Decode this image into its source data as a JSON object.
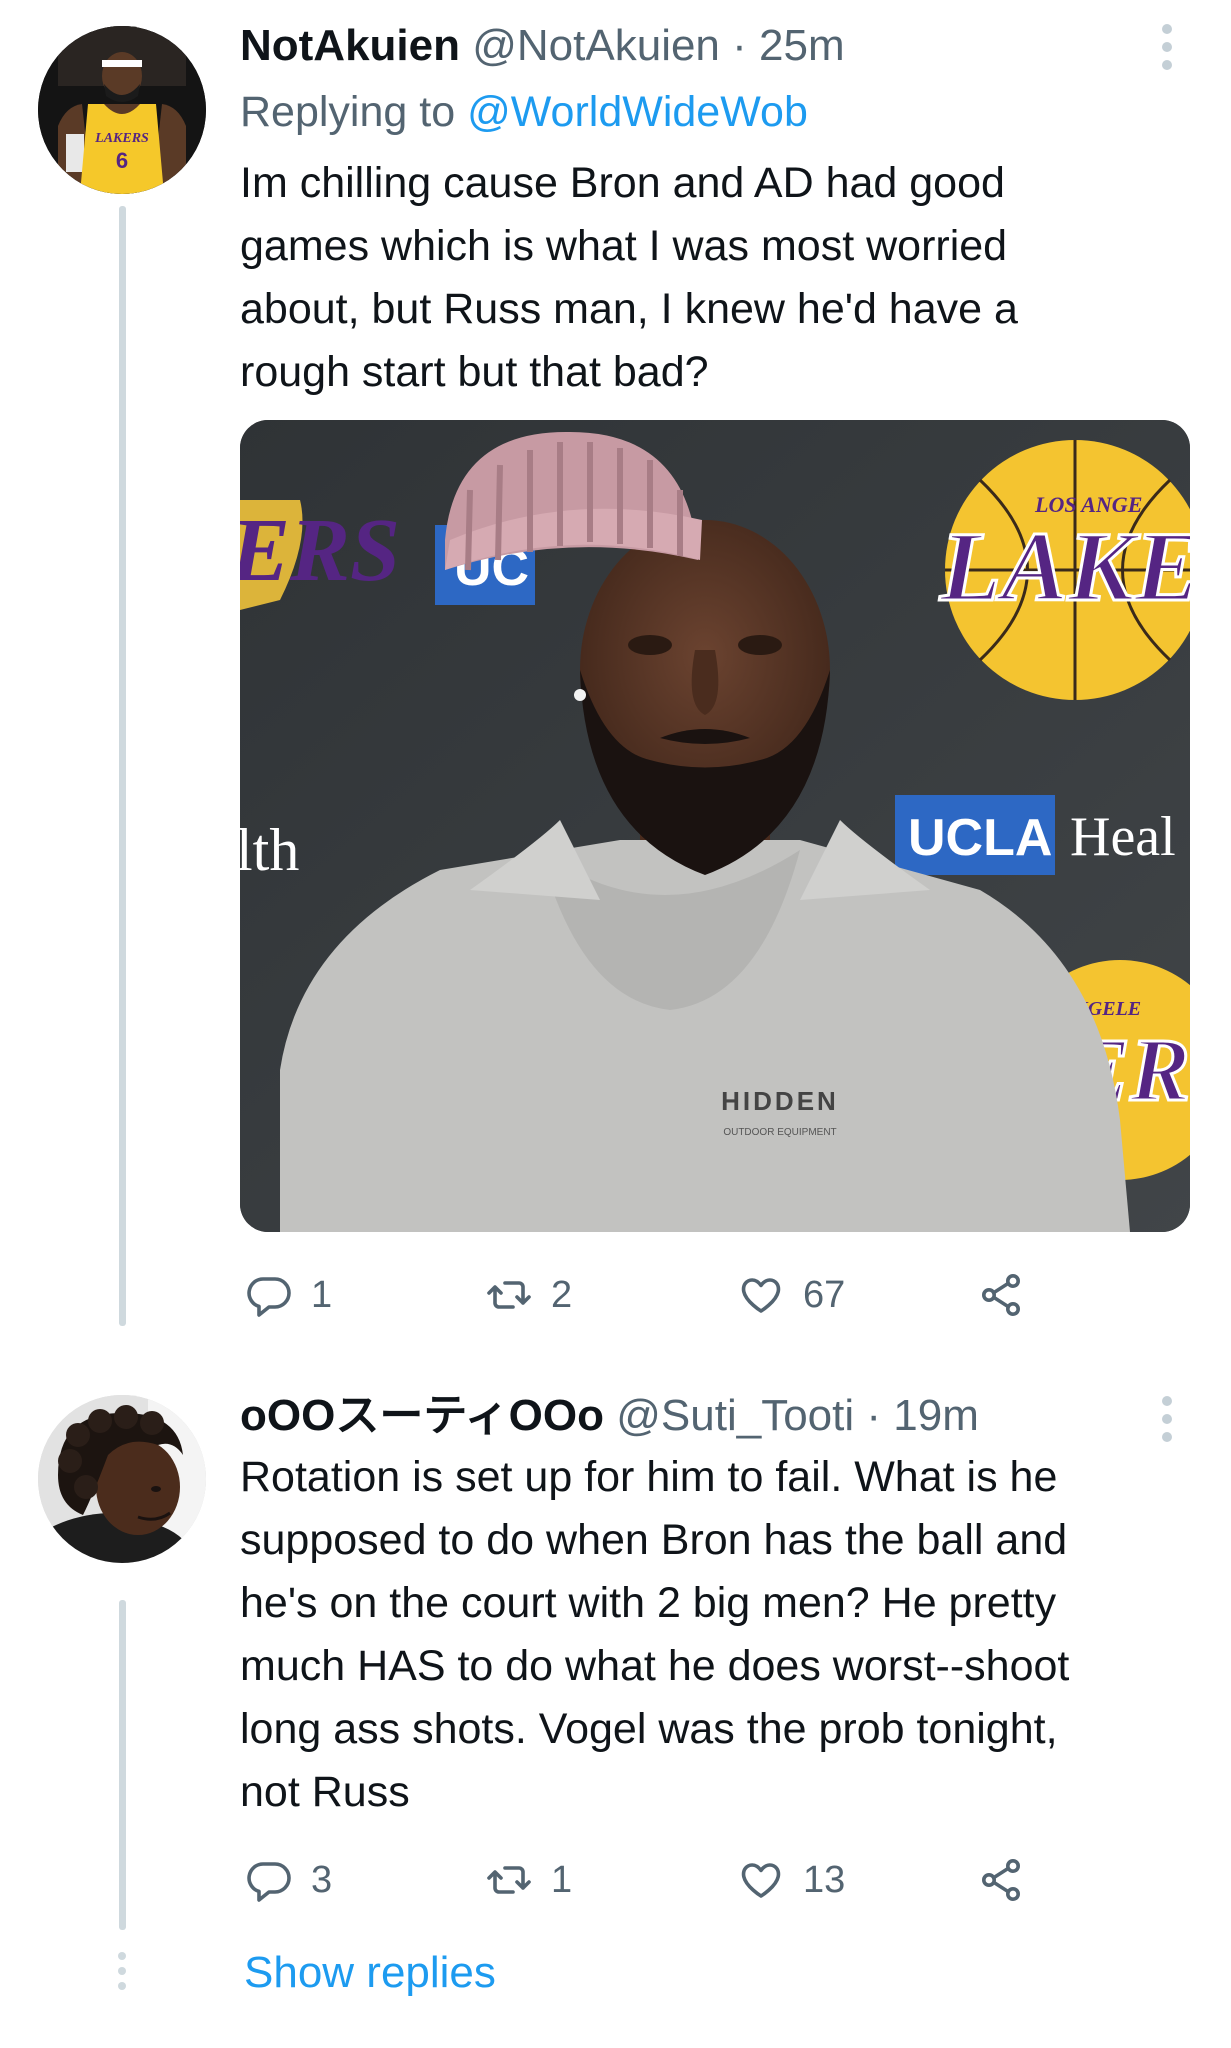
{
  "tweets": [
    {
      "name": "NotAkuien",
      "handle": "@NotAkuien",
      "separator": "·",
      "time": "25m",
      "replying_prefix": "Replying to",
      "replying_to": "@WorldWideWob",
      "text": "Im chilling cause Bron and AD had good\ngames which is what I was most worried\nabout, but Russ man, I knew he'd have a\nrough start but that bad?",
      "media": {
        "backdrop_texts": [
          "UC",
          "UCLA",
          "Heal",
          "lth",
          "LOS ANGE",
          "LAKER",
          "ANGELE",
          "ERS"
        ],
        "shirt_text": [
          "HIDDEN",
          "OUTDOOR EQUIPMENT"
        ]
      },
      "stats": {
        "replies": "1",
        "retweets": "2",
        "likes": "67"
      }
    },
    {
      "name": "oOOスーティOOo",
      "handle": "@Suti_Tooti",
      "separator": "·",
      "time": "19m",
      "text": "Rotation is set up for him to fail. What is he\nsupposed to do when Bron has the ball and\nhe's on the court with 2 big men? He pretty\nmuch HAS to do what he does worst--shoot\nlong ass shots. Vogel was the prob tonight,\nnot Russ",
      "stats": {
        "replies": "3",
        "retweets": "1",
        "likes": "13"
      }
    }
  ],
  "show_replies_label": "Show replies",
  "colors": {
    "link": "#1d9bf0",
    "secondary": "#536471",
    "thread_line": "#cfd9de"
  },
  "icons": [
    "reply-icon",
    "retweet-icon",
    "like-icon",
    "share-icon",
    "more-icon"
  ]
}
